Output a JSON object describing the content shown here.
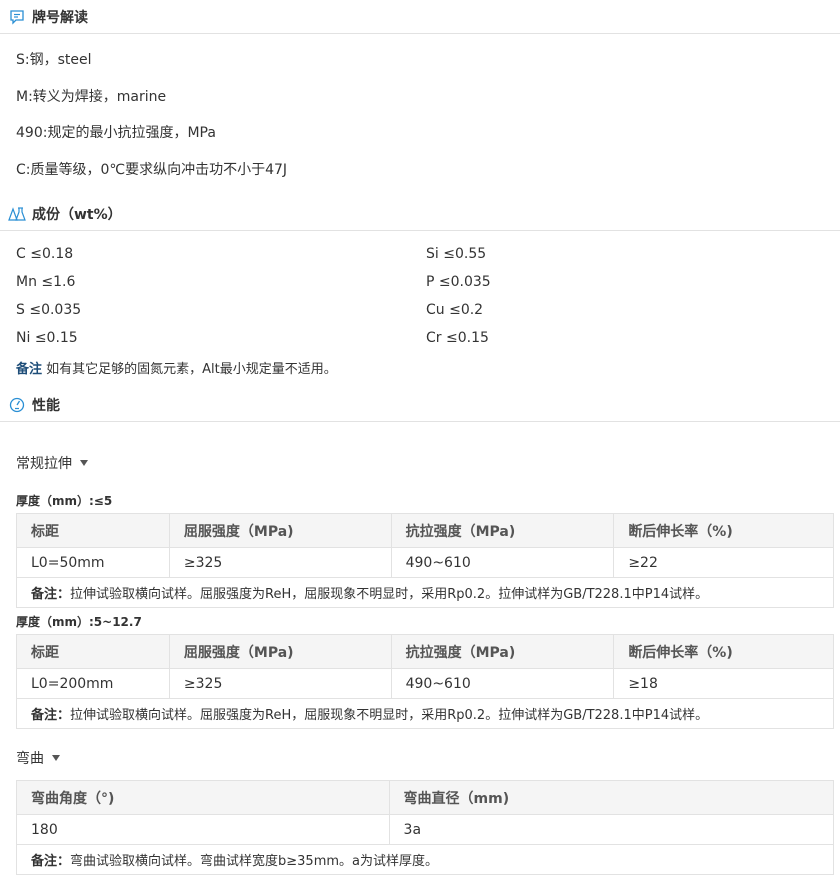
{
  "designation": {
    "title": "牌号解读",
    "lines": [
      "S:钢，steel",
      "M:转义为焊接，marine",
      "490:规定的最小抗拉强度，MPa",
      "C:质量等级，0℃要求纵向冲击功不小于47J"
    ]
  },
  "composition": {
    "title": "成份（wt%）",
    "items": [
      [
        "C ≤0.18",
        "Si ≤0.55"
      ],
      [
        "Mn ≤1.6",
        "P ≤0.035"
      ],
      [
        "S ≤0.035",
        "Cu ≤0.2"
      ],
      [
        "Ni ≤0.15",
        "Cr ≤0.15"
      ]
    ],
    "note_label": "备注",
    "note_text": " 如有其它足够的固氮元素，Alt最小规定量不适用。"
  },
  "performance": {
    "title": "性能",
    "tensile": {
      "label": "常规拉伸",
      "headers": [
        "标距",
        "屈服强度（MPa)",
        "抗拉强度（MPa)",
        "断后伸长率（%)"
      ],
      "groups": [
        {
          "thickness": "厚度（mm）:≤5",
          "row": [
            "L0=50mm",
            "≥325",
            "490~610",
            "≥22"
          ],
          "note_label": "备注：",
          "note_text": "拉伸试验取横向试样。屈服强度为ReH，屈服现象不明显时，采用Rp0.2。拉伸试样为GB/T228.1中P14试样。"
        },
        {
          "thickness": "厚度（mm）:5~12.7",
          "row": [
            "L0=200mm",
            "≥325",
            "490~610",
            "≥18"
          ],
          "note_label": "备注：",
          "note_text": "拉伸试验取横向试样。屈服强度为ReH，屈服现象不明显时，采用Rp0.2。拉伸试样为GB/T228.1中P14试样。"
        }
      ]
    },
    "bending": {
      "label": "弯曲",
      "headers": [
        "弯曲角度（°)",
        "弯曲直径（mm)"
      ],
      "row": [
        "180",
        "3a"
      ],
      "note_label": "备注：",
      "note_text": "弯曲试验取横向试样。弯曲试样宽度b≥35mm。a为试样厚度。"
    }
  },
  "colors": {
    "icon": "#2a8fd4",
    "note_label": "#1f4e79",
    "border": "#e2e2e2",
    "header_bg": "#f5f5f5"
  }
}
